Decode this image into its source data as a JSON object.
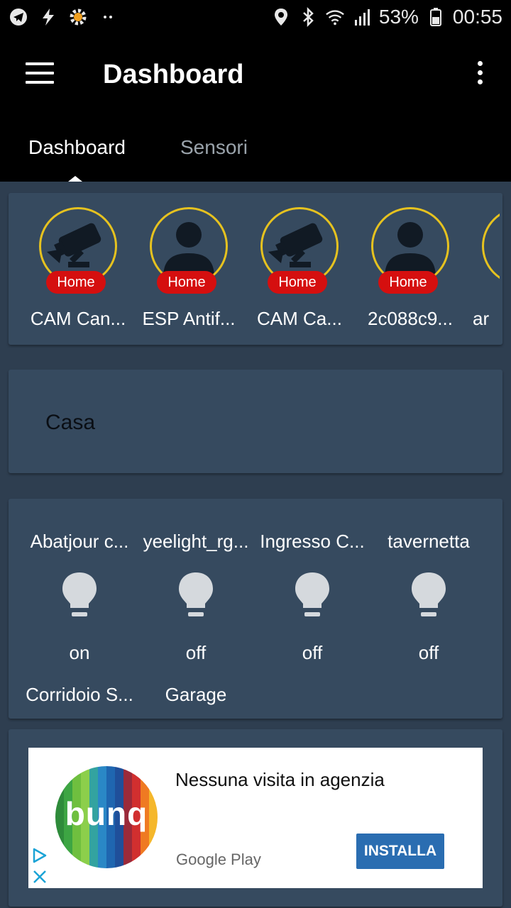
{
  "status_bar": {
    "battery": "53%",
    "time": "00:55",
    "icons": [
      "telegram-icon",
      "flash-icon",
      "gear-notification-icon",
      "more-dots-icon",
      "location-icon",
      "bluetooth-icon",
      "wifi-icon",
      "signal-icon",
      "battery-icon"
    ]
  },
  "app_bar": {
    "title": "Dashboard",
    "tabs": [
      {
        "label": "Dashboard",
        "selected": true
      },
      {
        "label": "Sensori",
        "selected": false
      }
    ]
  },
  "avatars": [
    {
      "label": "CAM Can...",
      "badge": "Home",
      "icon": "camera-icon"
    },
    {
      "label": "ESP Antif...",
      "badge": "Home",
      "icon": "person-icon"
    },
    {
      "label": "CAM Ca...",
      "badge": "Home",
      "icon": "camera-icon"
    },
    {
      "label": "2c088c9...",
      "badge": "Home",
      "icon": "person-icon"
    },
    {
      "label": "ar",
      "badge": "",
      "icon": "partial-avatar"
    }
  ],
  "group": {
    "title": "Casa"
  },
  "lights": [
    {
      "name": "Abatjour c...",
      "state": "on"
    },
    {
      "name": "yeelight_rg...",
      "state": "off"
    },
    {
      "name": "Ingresso C...",
      "state": "off"
    },
    {
      "name": "tavernetta",
      "state": "off"
    },
    {
      "name": "Corridoio S...",
      "state": ""
    },
    {
      "name": "Garage",
      "state": ""
    }
  ],
  "ad": {
    "logo_text": "bunq",
    "headline": "Nessuna visita in agenzia",
    "store": "Google Play",
    "cta": "INSTALLA"
  },
  "colors": {
    "background": "#2e3e50",
    "card": "#364a5f",
    "avatar_ring": "#e6c21f",
    "badge": "#d50f0f",
    "bulb": "#d5d9dd",
    "ad_button": "#2a6db1"
  }
}
